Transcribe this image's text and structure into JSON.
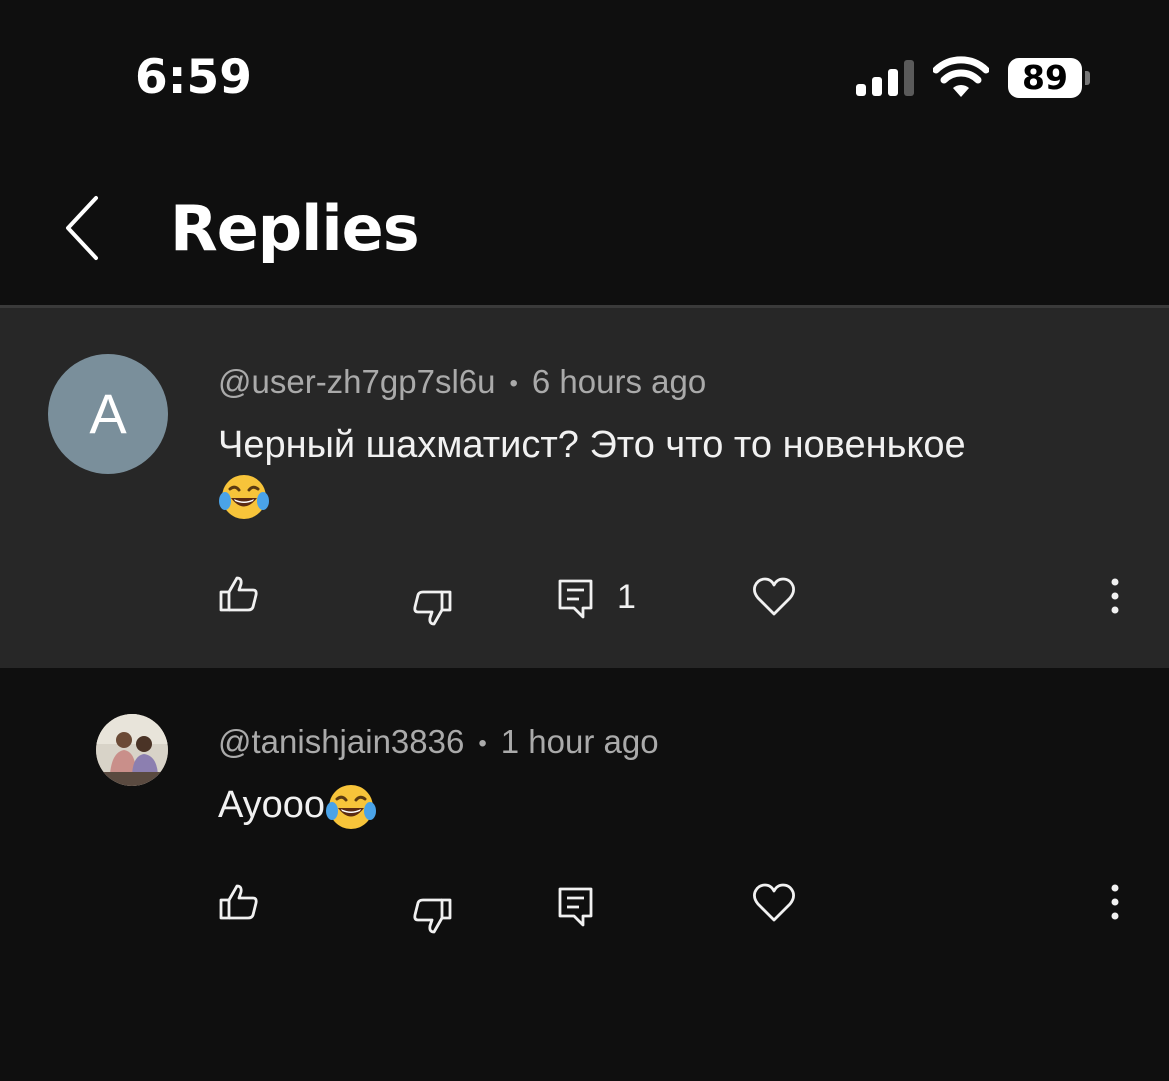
{
  "status_bar": {
    "time": "6:59",
    "battery": "89"
  },
  "header": {
    "title": "Replies",
    "back_icon": "chevron-left-icon"
  },
  "parent_comment": {
    "avatar_letter": "A",
    "avatar_color": "#7a8f9b",
    "author": "@user-zh7gp7sl6u",
    "separator": "•",
    "time": "6 hours ago",
    "text": "Черный шахматист? Это что то новенькое",
    "emoji": "face-with-tears-of-joy",
    "reply_count": "1",
    "background": "#272727"
  },
  "reply": {
    "author": "@tanishjain3836",
    "separator": "•",
    "time": "1 hour ago",
    "text": "Ayooo",
    "emoji": "face-with-tears-of-joy"
  },
  "icons": {
    "like": "thumbs-up-icon",
    "dislike": "thumbs-down-icon",
    "reply": "comment-icon",
    "heart": "heart-icon",
    "more": "more-vertical-icon"
  }
}
